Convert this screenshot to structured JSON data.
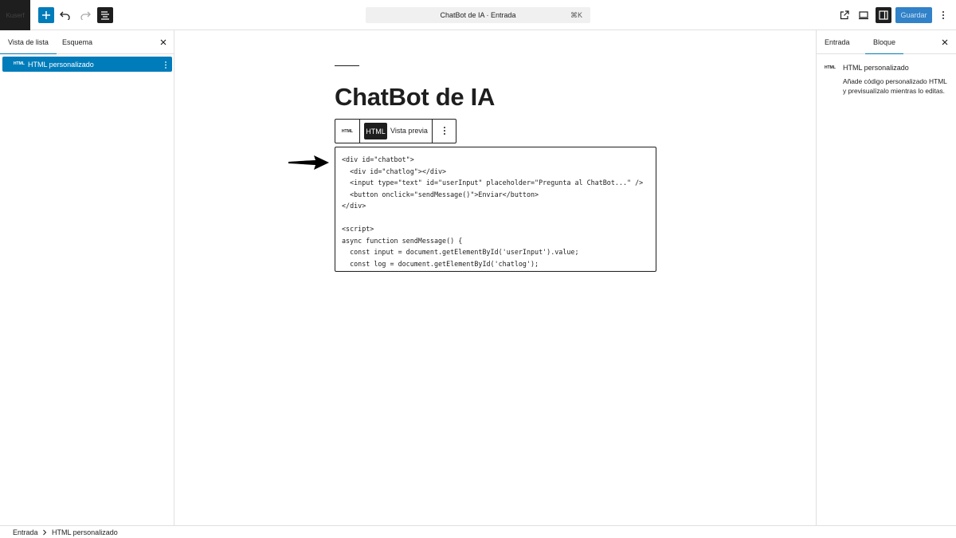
{
  "topbar": {
    "logo_text": "Kuserf",
    "command_bar_title": "ChatBot de IA · Entrada",
    "command_shortcut": "⌘K",
    "save_label": "Guardar"
  },
  "left_panel": {
    "tabs": [
      {
        "label": "Vista de lista"
      },
      {
        "label": "Esquema"
      }
    ],
    "items": [
      {
        "icon_text": "HTML",
        "label": "HTML personalizado"
      }
    ]
  },
  "canvas": {
    "post_title": "ChatBot de IA",
    "block_toolbar": {
      "icon_text": "HTML",
      "html_label": "HTML",
      "preview_label": "Vista previa"
    },
    "code_lines": [
      "<div id=\"chatbot\">",
      "  <div id=\"chatlog\"></div>",
      "  <input type=\"text\" id=\"userInput\" placeholder=\"Pregunta al ChatBot...\" />",
      "  <button onclick=\"sendMessage()\">Enviar</button>",
      "</div>",
      "",
      "<script>",
      "async function sendMessage() {",
      "  const input = document.getElementById('userInput').value;",
      "  const log = document.getElementById('chatlog');"
    ]
  },
  "right_panel": {
    "tabs": [
      {
        "label": "Entrada"
      },
      {
        "label": "Bloque"
      }
    ],
    "block_icon_text": "HTML",
    "block_title": "HTML personalizado",
    "block_description": "Añade código personalizado HTML y previsualízalo mientras lo editas."
  },
  "breadcrumb": {
    "items": [
      {
        "label": "Entrada"
      },
      {
        "label": "HTML personalizado"
      }
    ]
  },
  "colors": {
    "accent": "#007cba",
    "dark": "#1e1e1e",
    "border": "#e0e0e0"
  }
}
